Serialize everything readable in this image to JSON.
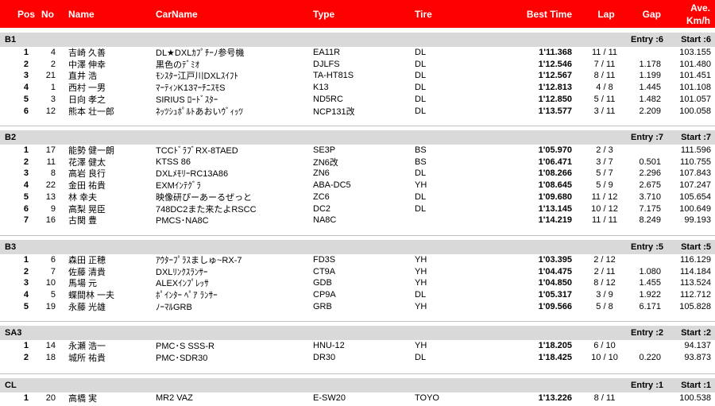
{
  "header": {
    "pos": "Pos",
    "no": "No",
    "name": "Name",
    "carname": "CarName",
    "type": "Type",
    "tire": "Tire",
    "best": "Best Time",
    "lap": "Lap",
    "gap": "Gap",
    "ave1": "Ave.",
    "ave2": "Km/h"
  },
  "colors": {
    "header_bg": "#ff0000",
    "class_bg": "#d9d9d9"
  },
  "classes": [
    {
      "name": "B1",
      "entry": "Entry :6",
      "start": "Start :6",
      "rows": [
        {
          "pos": "1",
          "no": "4",
          "name": "吉崎 久善",
          "car": "DL★DXLｶﾌﾟﾁｰﾉ参号機",
          "type": "EA11R",
          "tire": "DL",
          "best": "1'11.368",
          "lap": "11 / 11",
          "gap": "",
          "ave": "103.155"
        },
        {
          "pos": "2",
          "no": "2",
          "name": "中澤 伸幸",
          "car": "黒色のﾃﾞﾐｵ",
          "type": "DJLFS",
          "tire": "DL",
          "best": "1'12.546",
          "lap": "7 / 11",
          "gap": "1.178",
          "ave": "101.480"
        },
        {
          "pos": "3",
          "no": "21",
          "name": "直井 浩",
          "car": "ﾓﾝｽﾀｰ江戸川DXLｽｲﾌﾄ",
          "type": "TA-HT81S",
          "tire": "DL",
          "best": "1'12.567",
          "lap": "8 / 11",
          "gap": "1.199",
          "ave": "101.451"
        },
        {
          "pos": "4",
          "no": "1",
          "name": "西村 一男",
          "car": "ﾏｰﾃｨﾝK13ﾏｰﾁﾆｽﾓS",
          "type": "K13",
          "tire": "DL",
          "best": "1'12.813",
          "lap": "4 / 8",
          "gap": "1.445",
          "ave": "101.108"
        },
        {
          "pos": "5",
          "no": "3",
          "name": "日向 孝之",
          "car": "SIRIUS ﾛｰﾄﾞｽﾀｰ",
          "type": "ND5RC",
          "tire": "DL",
          "best": "1'12.850",
          "lap": "5 / 11",
          "gap": "1.482",
          "ave": "101.057"
        },
        {
          "pos": "6",
          "no": "12",
          "name": "熊本 壮一郎",
          "car": "ﾈｯﾂｼｭﾎﾟﾙﾄあおいｳﾞｨｯﾂ",
          "type": "NCP131改",
          "tire": "DL",
          "best": "1'13.577",
          "lap": "3 / 11",
          "gap": "2.209",
          "ave": "100.058"
        }
      ]
    },
    {
      "name": "B2",
      "entry": "Entry :7",
      "start": "Start :7",
      "rows": [
        {
          "pos": "1",
          "no": "17",
          "name": "能勢 健一朗",
          "car": "TCCﾄﾞﾗﾌﾞRX-8TAED",
          "type": "SE3P",
          "tire": "BS",
          "best": "1'05.970",
          "lap": "2 / 3",
          "gap": "",
          "ave": "111.596"
        },
        {
          "pos": "2",
          "no": "11",
          "name": "花澤 健太",
          "car": "KTSS 86",
          "type": "ZN6改",
          "tire": "BS",
          "best": "1'06.471",
          "lap": "3 / 7",
          "gap": "0.501",
          "ave": "110.755"
        },
        {
          "pos": "3",
          "no": "8",
          "name": "高岩 良行",
          "car": "DXLﾒﾓﾘｰRC13A86",
          "type": "ZN6",
          "tire": "DL",
          "best": "1'08.266",
          "lap": "5 / 7",
          "gap": "2.296",
          "ave": "107.843"
        },
        {
          "pos": "4",
          "no": "22",
          "name": "金田 祐貴",
          "car": "EXMｲﾝﾃｸﾞﾗ",
          "type": "ABA-DC5",
          "tire": "YH",
          "best": "1'08.645",
          "lap": "5 / 9",
          "gap": "2.675",
          "ave": "107.247"
        },
        {
          "pos": "5",
          "no": "13",
          "name": "林 幸夫",
          "car": "映像研ぴーあーるぜっと",
          "type": "ZC6",
          "tire": "DL",
          "best": "1'09.680",
          "lap": "11 / 12",
          "gap": "3.710",
          "ave": "105.654"
        },
        {
          "pos": "6",
          "no": "9",
          "name": "高梨 晃臣",
          "car": "748DC2また来たよRSCC",
          "type": "DC2",
          "tire": "DL",
          "best": "1'13.145",
          "lap": "10 / 12",
          "gap": "7.175",
          "ave": "100.649"
        },
        {
          "pos": "7",
          "no": "16",
          "name": "古関 豊",
          "car": "PMCS･NA8C",
          "type": "NA8C",
          "tire": "",
          "best": "1'14.219",
          "lap": "11 / 11",
          "gap": "8.249",
          "ave": "99.193"
        }
      ]
    },
    {
      "name": "B3",
      "entry": "Entry :5",
      "start": "Start :5",
      "rows": [
        {
          "pos": "1",
          "no": "6",
          "name": "森田 正穂",
          "car": "ｱｳﾀｰﾌﾟﾗｽましゅ~RX-7",
          "type": "FD3S",
          "tire": "YH",
          "best": "1'03.395",
          "lap": "2 / 12",
          "gap": "",
          "ave": "116.129"
        },
        {
          "pos": "2",
          "no": "7",
          "name": "佐藤 清貴",
          "car": "DXLﾘﾝｸｽﾗﾝｻｰ",
          "type": "CT9A",
          "tire": "YH",
          "best": "1'04.475",
          "lap": "2 / 11",
          "gap": "1.080",
          "ave": "114.184"
        },
        {
          "pos": "3",
          "no": "10",
          "name": "馬場 元",
          "car": "ALEXｲﾝﾌﾟﾚｯｻ",
          "type": "GDB",
          "tire": "YH",
          "best": "1'04.850",
          "lap": "8 / 12",
          "gap": "1.455",
          "ave": "113.524"
        },
        {
          "pos": "4",
          "no": "5",
          "name": "蝶間林 一夫",
          "car": "ﾎﾟｲﾝﾀｰ ﾍﾟｱ ﾗﾝｻｰ",
          "type": "CP9A",
          "tire": "DL",
          "best": "1'05.317",
          "lap": "3 / 9",
          "gap": "1.922",
          "ave": "112.712"
        },
        {
          "pos": "5",
          "no": "19",
          "name": "永藤 光雄",
          "car": "ﾉｰﾏﾙGRB",
          "type": "GRB",
          "tire": "YH",
          "best": "1'09.566",
          "lap": "5 / 8",
          "gap": "6.171",
          "ave": "105.828"
        }
      ]
    },
    {
      "name": "SA3",
      "entry": "Entry :2",
      "start": "Start :2",
      "rows": [
        {
          "pos": "1",
          "no": "14",
          "name": "永瀬 浩一",
          "car": "PMC･S SSS-R",
          "type": "HNU-12",
          "tire": "YH",
          "best": "1'18.205",
          "lap": "6 / 10",
          "gap": "",
          "ave": "94.137"
        },
        {
          "pos": "2",
          "no": "18",
          "name": "城所 祐貴",
          "car": "PMC･SDR30",
          "type": "DR30",
          "tire": "DL",
          "best": "1'18.425",
          "lap": "10 / 10",
          "gap": "0.220",
          "ave": "93.873"
        }
      ]
    },
    {
      "name": "CL",
      "entry": "Entry :1",
      "start": "Start :1",
      "rows": [
        {
          "pos": "1",
          "no": "20",
          "name": "高橋 実",
          "car": "MR2 VAZ",
          "type": "E-SW20",
          "tire": "TOYO",
          "best": "1'13.226",
          "lap": "8 / 11",
          "gap": "",
          "ave": "100.538"
        }
      ]
    }
  ]
}
